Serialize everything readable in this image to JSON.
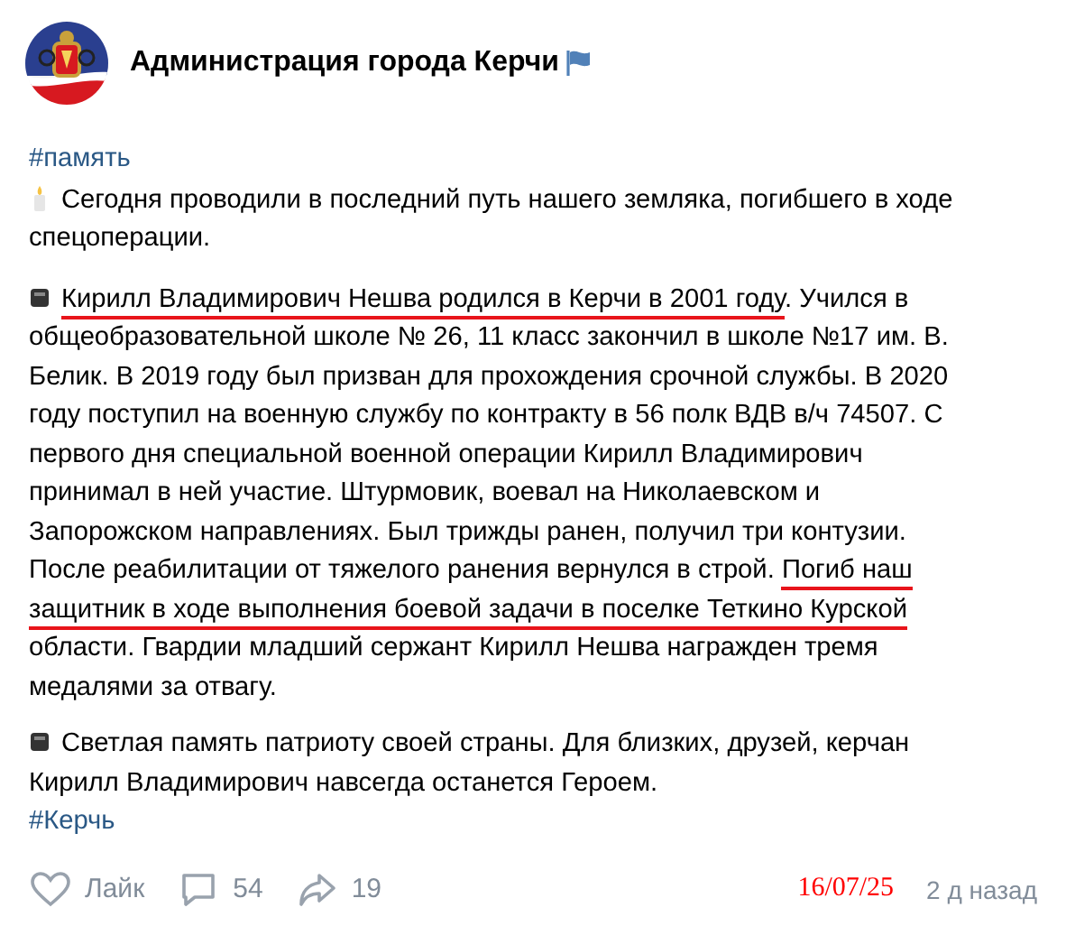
{
  "header": {
    "title": "Администрация города Керчи"
  },
  "post": {
    "hashtag_top": "#память",
    "paragraphs": [
      {
        "kind": "candle",
        "segments": [
          {
            "text": "Сегодня проводили в последний путь нашего земляка, погибшего в ходе спецоперации.",
            "underlined": false
          }
        ]
      },
      {
        "kind": "square",
        "segments": [
          {
            "text": "Кирилл Владимирович Нешва родился в Керчи в 2001 году",
            "underlined": true
          },
          {
            "text": ". Учился в общеобразовательной школе № 26, 11 класс закончил в школе №17 им. В. Белик. В 2019 году был призван для прохождения срочной службы. В 2020 году поступил на военную службу по контракту в 56 полк ВДВ в/ч 74507. С первого дня специальной военной операции Кирилл Владимирович принимал в ней участие. Штурмовик, воевал на Николаевском и Запорожском направлениях. Был трижды ранен, получил три контузии. После реабилитации от тяжелого ранения вернулся в строй. ",
            "underlined": false
          },
          {
            "text": "Погиб наш защитник в ходе выполнения боевой задачи в поселке Теткино Курской",
            "underlined": true
          },
          {
            "text": " области. Гвардии младший сержант Кирилл Нешва награжден тремя медалями за отвагу.",
            "underlined": false
          }
        ]
      },
      {
        "kind": "square",
        "segments": [
          {
            "text": "Светлая память патриоту своей страны. Для близких, друзей, керчан Кирилл Владимирович навсегда останется Героем.",
            "underlined": false
          }
        ]
      }
    ],
    "hashtag_bottom": "#Керчь"
  },
  "footer": {
    "like": "Лайк",
    "comments": "54",
    "shares": "19",
    "date": "16/07/25",
    "time": "2 д назад"
  }
}
